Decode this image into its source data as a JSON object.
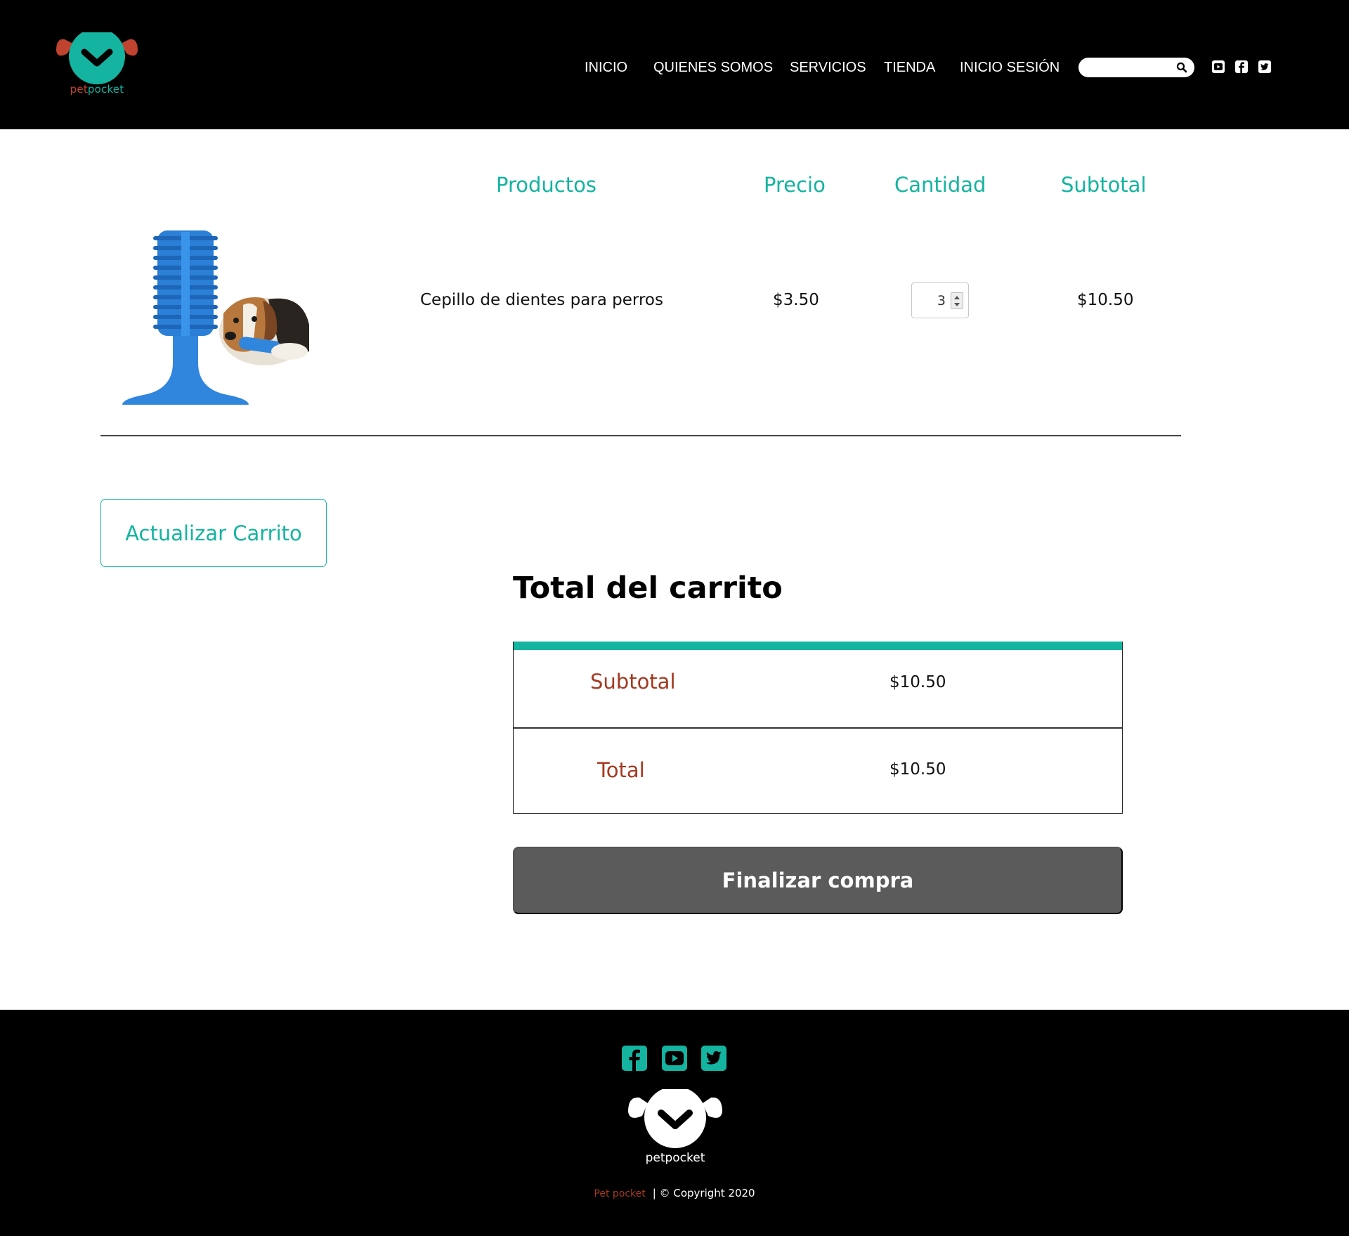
{
  "header": {
    "logo_text_a": "pet",
    "logo_text_b": "pocket",
    "nav": [
      {
        "label": "INICIO"
      },
      {
        "label": "QUIENES SOMOS"
      },
      {
        "label": "SERVICIOS"
      },
      {
        "label": "TIENDA"
      },
      {
        "label": "INICIO SESIÓN"
      }
    ],
    "search": {
      "value": "",
      "icon": "search-icon"
    },
    "social": [
      "youtube-icon",
      "facebook-icon",
      "twitter-icon"
    ]
  },
  "cart": {
    "columns": {
      "product": "Productos",
      "price": "Precio",
      "quantity": "Cantidad",
      "subtotal": "Subtotal"
    },
    "items": [
      {
        "name": "Cepillo de dientes para perros",
        "price": "$3.50",
        "quantity": "3",
        "subtotal": "$10.50",
        "image": "dog-toothbrush-toy-image"
      }
    ],
    "update_label": "Actualizar Carrito"
  },
  "totals": {
    "title": "Total del carrito",
    "subtotal_label": "Subtotal",
    "subtotal_value": "$10.50",
    "total_label": "Total",
    "total_value": "$10.50",
    "checkout_label": "Finalizar compra"
  },
  "footer": {
    "social": [
      "facebook-icon",
      "youtube-icon",
      "twitter-icon"
    ],
    "logo_text": "petpocket",
    "brand": "Pet pocket",
    "copyright": "| © Copyright 2020"
  },
  "colors": {
    "accent": "#14b4a0",
    "brand_red": "#c0432f",
    "label_red": "#a33a22",
    "checkout": "#5b5b5b"
  }
}
